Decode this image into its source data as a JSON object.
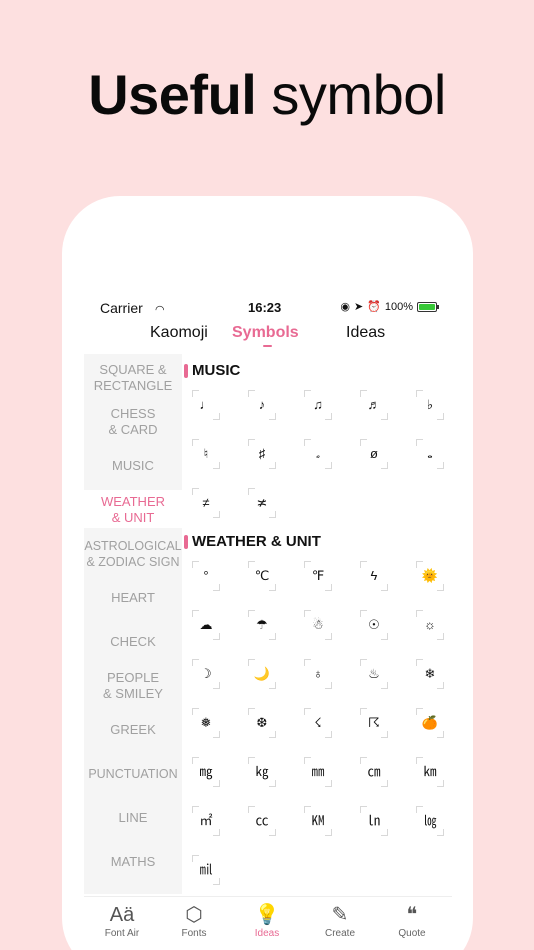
{
  "headline": {
    "bold": "Useful",
    "light": " symbol"
  },
  "status": {
    "carrier": "Carrier",
    "time": "16:23",
    "battery": "100%"
  },
  "tabs": [
    {
      "label": "Kaomoji"
    },
    {
      "label": "Symbols"
    },
    {
      "label": "Ideas"
    }
  ],
  "sidebar": [
    {
      "label": "SQUARE &\nRECTANGLE"
    },
    {
      "label": "CHESS\n& CARD"
    },
    {
      "label": "MUSIC"
    },
    {
      "label": "WEATHER\n& UNIT"
    },
    {
      "label": "ASTROLOGICAL\n& ZODIAC SIGN"
    },
    {
      "label": "HEART"
    },
    {
      "label": "CHECK"
    },
    {
      "label": "PEOPLE\n& SMILEY"
    },
    {
      "label": "GREEK"
    },
    {
      "label": "PUNCTUATION"
    },
    {
      "label": "LINE"
    },
    {
      "label": "MATHS"
    }
  ],
  "sections": [
    {
      "title": "MUSIC",
      "symbols": [
        "♩",
        "♪",
        "♫",
        "♬",
        "♭",
        "♮",
        "♯",
        "𝅗",
        "ø",
        "𝅝",
        "≠",
        "≭"
      ]
    },
    {
      "title": "WEATHER & UNIT",
      "symbols": [
        "°",
        "℃",
        "℉",
        "ϟ",
        "🌞",
        "☁",
        "☂",
        "☃",
        "☉",
        "☼",
        "☽",
        "🌙",
        "♁",
        "♨",
        "❄",
        "❅",
        "❆",
        "☇",
        "☈",
        "🍊",
        "㎎",
        "㎏",
        "㎜",
        "㎝",
        "㎞",
        "㎡",
        "㏄",
        "㏎",
        "㏑",
        "㏒",
        "㏕"
      ]
    }
  ],
  "nav": [
    {
      "icon": "Aä",
      "label": "Font Air"
    },
    {
      "icon": "⬡",
      "label": "Fonts"
    },
    {
      "icon": "💡",
      "label": "Ideas"
    },
    {
      "icon": "✎",
      "label": "Create"
    },
    {
      "icon": "❝",
      "label": "Quote"
    }
  ],
  "colors": {
    "accent": "#e86a93",
    "background": "#fde0e0"
  }
}
